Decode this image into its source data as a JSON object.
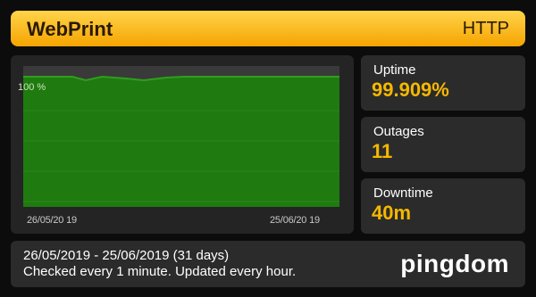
{
  "header": {
    "title": "WebPrint",
    "protocol": "HTTP"
  },
  "chart": {
    "y_label": "100 %",
    "x_start": "26/05/20 19",
    "x_end": "25/06/20 19",
    "fill_color": "#1f7a10",
    "line_color": "#2f9f1d"
  },
  "stats": [
    {
      "label": "Uptime",
      "value": "99.909%"
    },
    {
      "label": "Outages",
      "value": "11"
    },
    {
      "label": "Downtime",
      "value": "40m"
    }
  ],
  "footer": {
    "range": "26/05/2019  - 25/06/2019  (31 days)",
    "checked": "Checked every 1 minute. Updated every hour.",
    "brand": "pingdom"
  },
  "colors": {
    "accent": "#f5b800",
    "header": "#ffd44a"
  }
}
